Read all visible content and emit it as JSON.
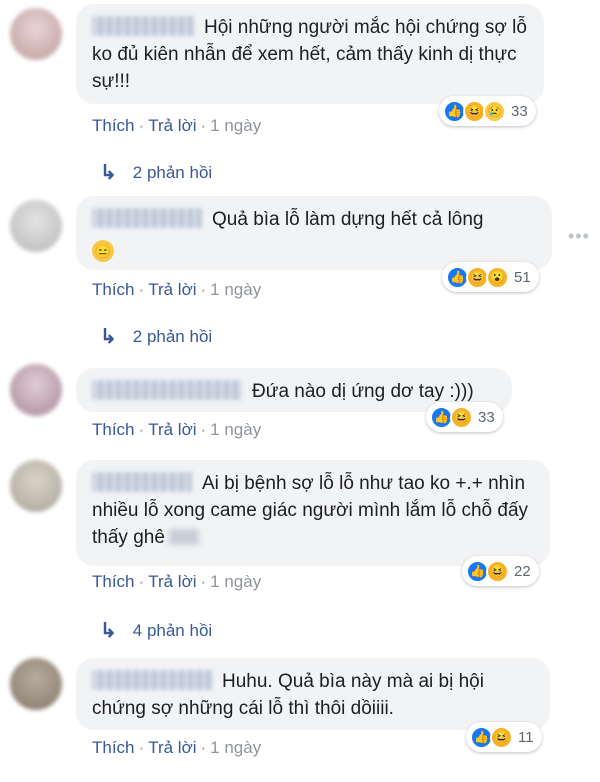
{
  "comments": [
    {
      "text": "Hội những người mắc hội chứng sợ lỗ ko đủ kiên nhẫn để xem hết, cảm thấy kinh dị thực sự!!!",
      "reactions": [
        "like",
        "haha",
        "sad"
      ],
      "reaction_count": "33",
      "actions": {
        "like": "Thích",
        "reply": "Trả lời",
        "time": "1 ngày"
      },
      "replies": "2 phản hồi",
      "avatar_color": "#c9a9a9"
    },
    {
      "text": "Quả bìa lỗ làm dựng hết cả lông",
      "emoji": "😑",
      "reactions": [
        "like",
        "haha",
        "wow"
      ],
      "reaction_count": "51",
      "actions": {
        "like": "Thích",
        "reply": "Trả lời",
        "time": "1 ngày"
      },
      "replies": "2 phản hồi",
      "avatar_color": "#c4c4c4"
    },
    {
      "text": "Đứa nào dị ứng dơ tay :)))",
      "reactions": [
        "like",
        "haha"
      ],
      "reaction_count": "33",
      "actions": {
        "like": "Thích",
        "reply": "Trả lời",
        "time": "1 ngày"
      },
      "avatar_color": "#b89aa8"
    },
    {
      "text": "Ai bị bệnh sợ lỗ lỗ như tao ko +.+ nhìn nhiều lỗ xong came giác người mình lắm lỗ chỗ đấy thấy ghê",
      "reactions": [
        "like",
        "haha"
      ],
      "reaction_count": "22",
      "actions": {
        "like": "Thích",
        "reply": "Trả lời",
        "time": "1 ngày"
      },
      "replies": "4 phản hồi",
      "avatar_color": "#b5b0a2"
    },
    {
      "text": "Huhu. Quả bìa này mà ai bị hội chứng sợ những cái lỗ thì thôi dồiiii.",
      "reactions": [
        "like",
        "haha"
      ],
      "reaction_count": "11",
      "actions": {
        "like": "Thích",
        "reply": "Trả lời",
        "time": "1 ngày"
      },
      "avatar_color": "#8f8070"
    }
  ],
  "icons": {
    "more": "more-horizontal-icon",
    "reply_arrow": "reply-arrow-icon"
  },
  "colors": {
    "link": "#385898",
    "bubble": "#f2f3f5",
    "like": "#1877f2",
    "haha": "#f7b125"
  }
}
